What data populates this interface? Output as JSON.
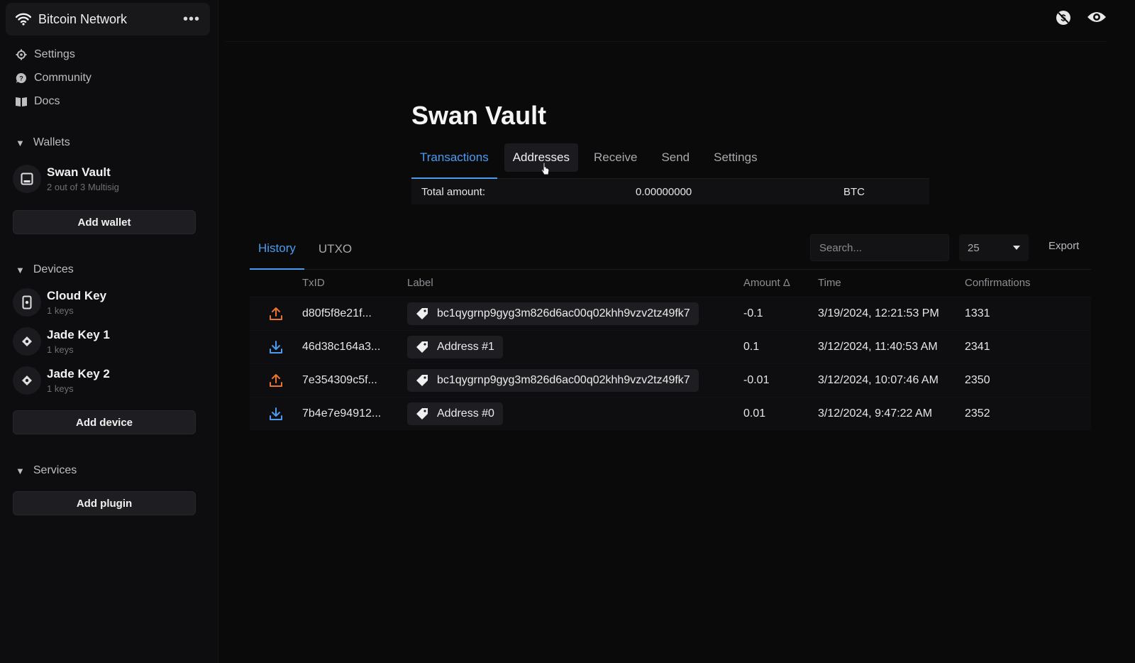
{
  "sidebar": {
    "network_name": "Bitcoin Network",
    "more_label": "•••",
    "links": [
      {
        "label": "Settings",
        "icon": "gear-icon"
      },
      {
        "label": "Community",
        "icon": "chat-icon"
      },
      {
        "label": "Docs",
        "icon": "book-icon"
      }
    ],
    "wallets_header": "Wallets",
    "wallets": [
      {
        "name": "Swan Vault",
        "sub": "2 out of 3 Multisig"
      }
    ],
    "add_wallet": "Add wallet",
    "devices_header": "Devices",
    "devices": [
      {
        "name": "Cloud Key",
        "sub": "1 keys"
      },
      {
        "name": "Jade Key 1",
        "sub": "1 keys"
      },
      {
        "name": "Jade Key 2",
        "sub": "1 keys"
      }
    ],
    "add_device": "Add device",
    "services_header": "Services",
    "add_plugin": "Add plugin"
  },
  "main": {
    "title": "Swan Vault",
    "tabs": [
      "Transactions",
      "Addresses",
      "Receive",
      "Send",
      "Settings"
    ],
    "active_tab": "Transactions",
    "total": {
      "label": "Total amount:",
      "value": "0.00000000",
      "unit": "BTC"
    },
    "subtabs": [
      "History",
      "UTXO"
    ],
    "search_placeholder": "Search...",
    "page_size": "25",
    "export_label": "Export",
    "columns": [
      "TxID",
      "Label",
      "Amount Δ",
      "Time",
      "Confirmations"
    ],
    "rows": [
      {
        "dir": "out",
        "txid": "d80f5f8e21f...",
        "label": "bc1qygrnp9gyg3m826d6ac00q02khh9vzv2tz49fk7",
        "amount": "-0.1",
        "time": "3/19/2024, 12:21:53 PM",
        "confirmations": "1331"
      },
      {
        "dir": "in",
        "txid": "46d38c164a3...",
        "label": "Address #1",
        "amount": "0.1",
        "time": "3/12/2024, 11:40:53 AM",
        "confirmations": "2341"
      },
      {
        "dir": "out",
        "txid": "7e354309c5f...",
        "label": "bc1qygrnp9gyg3m826d6ac00q02khh9vzv2tz49fk7",
        "amount": "-0.01",
        "time": "3/12/2024, 10:07:46 AM",
        "confirmations": "2350"
      },
      {
        "dir": "in",
        "txid": "7b4e7e94912...",
        "label": "Address #0",
        "amount": "0.01",
        "time": "3/12/2024, 9:47:22 AM",
        "confirmations": "2352"
      }
    ]
  },
  "colors": {
    "accent": "#4b9cf0",
    "outgoing": "#e8742f",
    "incoming": "#4b9cf0"
  }
}
